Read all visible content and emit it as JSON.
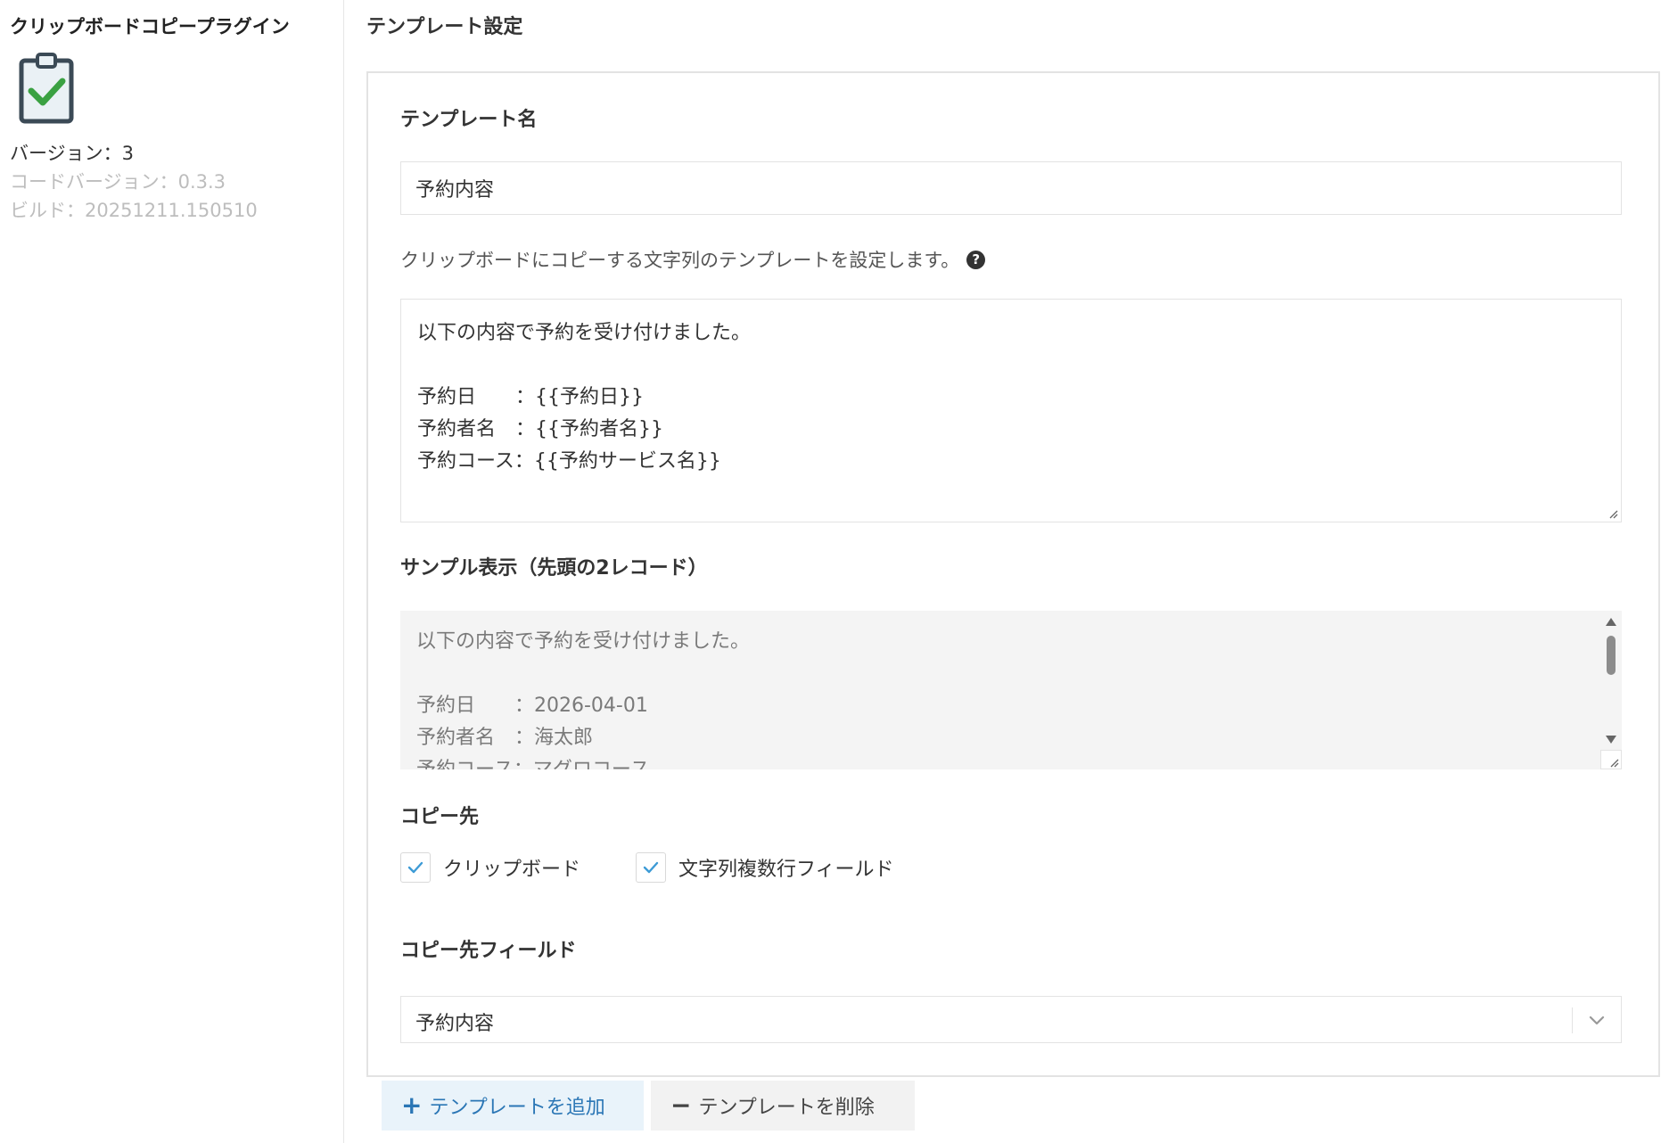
{
  "sidebar": {
    "plugin_name": "クリップボードコピープラグイン",
    "logo_icon": "clipboard-check-icon",
    "version": "バージョン：3",
    "code_version": "コードバージョン：0.3.3",
    "build": "ビルド：20251211.150510"
  },
  "main": {
    "title": "テンプレート設定",
    "template_name_label": "テンプレート名",
    "template_name_value": "予約内容",
    "description": "クリップボードにコピーする文字列のテンプレートを設定します。",
    "help_icon": "question-circle-icon",
    "template_lines": [
      "以下の内容で予約を受け付けました。",
      "",
      "予約日　　：{{予約日}}",
      "予約者名　：{{予約者名}}",
      "予約コース：{{予約サービス名}}"
    ],
    "sample_label": "サンプル表示（先頭の2レコード）",
    "sample_lines": [
      "以下の内容で予約を受け付けました。",
      "",
      "予約日　　：2026-04-01",
      "予約者名　：海太郎",
      "予約コース：マグロコース"
    ],
    "copy_target_label": "コピー先",
    "copy_targets": [
      {
        "label": "クリップボード",
        "checked": true
      },
      {
        "label": "文字列複数行フィールド",
        "checked": true
      }
    ],
    "copy_field_label": "コピー先フィールド",
    "copy_field_value": "予約内容"
  },
  "buttons": {
    "add_label": "テンプレートを追加",
    "delete_label": "テンプレートを削除"
  },
  "colors": {
    "accent": "#2a76b5",
    "check": "#3d9bd6",
    "logo_check": "#3aa142"
  }
}
